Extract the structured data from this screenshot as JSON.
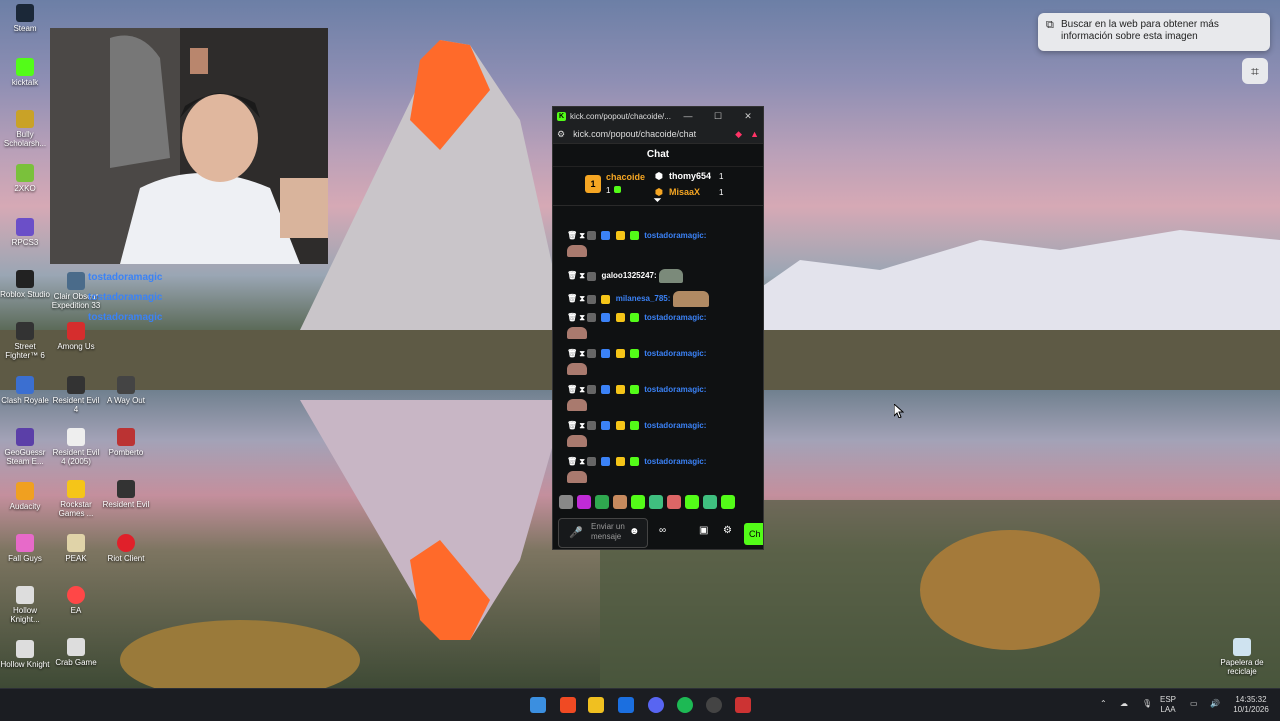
{
  "desktop": {
    "icons_col1": [
      "Steam",
      "kicktalk",
      "Bully Scholarsh...",
      "2XKO",
      "RPCS3",
      "Roblox Studio",
      "Street Fighter™ 6",
      "Clash Royale",
      "GeoGuessr Steam E...",
      "Audacity",
      "Fall Guys",
      "Hollow Knight...",
      "Hollow Knight"
    ],
    "icons_col2": [
      "Clair Obscur Expedition 33",
      "Among Us",
      "Resident Evil 4",
      "Resident Evil 4 (2005)",
      "Rockstar Games ...",
      "PEAK",
      "EA",
      "Crab Game"
    ],
    "icons_col3": [
      "A Way Out",
      "Pomberto",
      "Resident Evil",
      "Riot Client"
    ],
    "recycle_bin": "Papelera de reciclaje",
    "overlay_names": [
      "tostadoramagic",
      "tostadoramagic",
      "tostadoramagic"
    ]
  },
  "lens": {
    "text": "Buscar en la web para obtener más información sobre esta imagen"
  },
  "browser": {
    "tab_title": "kick.com/popout/chacoide/...",
    "url": "kick.com/popout/chacoide/chat",
    "favicon": "K",
    "chat_title": "Chat",
    "leaders": [
      {
        "rank": "1",
        "name": "chacoide",
        "count": "1"
      },
      {
        "name": "thomy654",
        "count": "1"
      },
      {
        "name": "MisaaX",
        "count": "1"
      }
    ],
    "messages": [
      {
        "user": "tostadoramagic:",
        "color": "#3b82f6"
      },
      {
        "user": "galoo1325247:",
        "color": "#ffffff"
      },
      {
        "user": "milanesa_785:",
        "color": "#3b82f6"
      },
      {
        "user": "tostadoramagic:",
        "color": "#3b82f6"
      },
      {
        "user": "tostadoramagic:",
        "color": "#3b82f6"
      },
      {
        "user": "tostadoramagic:",
        "color": "#3b82f6"
      },
      {
        "user": "tostadoramagic:",
        "color": "#3b82f6"
      },
      {
        "user": "tostadoramagic:",
        "color": "#3b82f6"
      }
    ],
    "input_placeholder": "Enviar un mensaje",
    "send_label": "Ch"
  },
  "taskbar": {
    "lang": "ESP",
    "lang2": "LAA",
    "time": "14:35:32",
    "date": "10/1/2026"
  },
  "colors": {
    "kick_green": "#53fc18",
    "chat_bg": "#0f1112",
    "leader_gold": "#f5a623"
  }
}
